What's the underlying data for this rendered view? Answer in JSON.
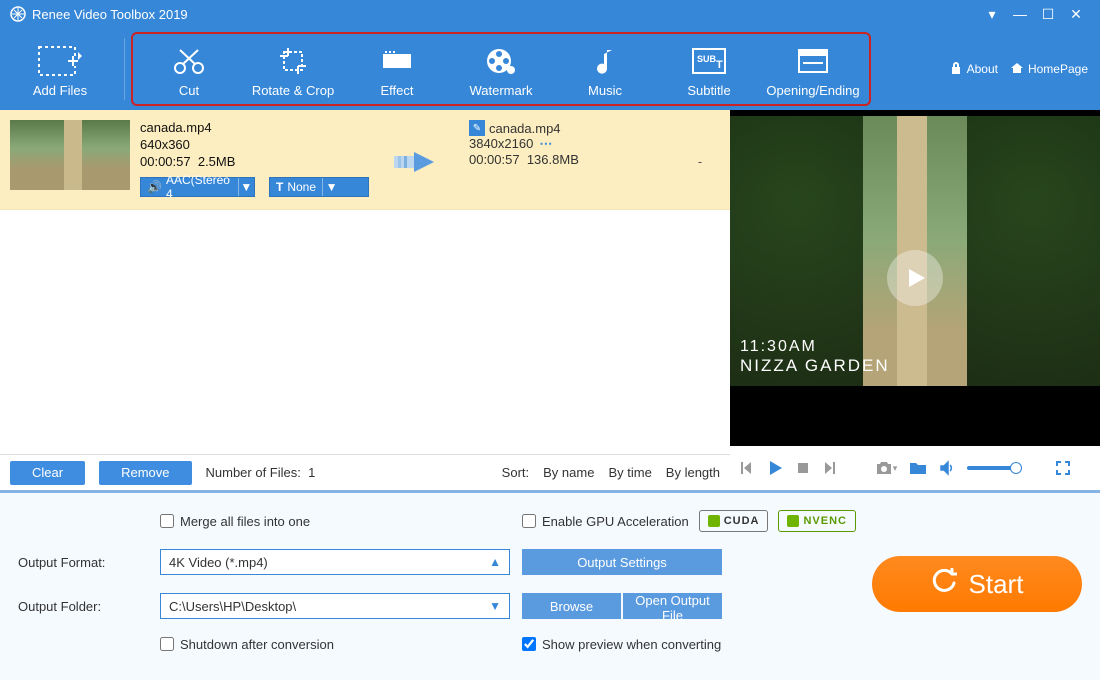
{
  "title": "Renee Video Toolbox 2019",
  "toolbar": {
    "add_files": "Add Files",
    "items": [
      {
        "label": "Cut"
      },
      {
        "label": "Rotate & Crop"
      },
      {
        "label": "Effect"
      },
      {
        "label": "Watermark"
      },
      {
        "label": "Music"
      },
      {
        "label": "Subtitle"
      },
      {
        "label": "Opening/Ending"
      }
    ],
    "about": "About",
    "homepage": "HomePage"
  },
  "file": {
    "source": {
      "name": "canada.mp4",
      "resolution": "640x360",
      "duration": "00:00:57",
      "size": "2.5MB"
    },
    "target": {
      "name": "canada.mp4",
      "resolution": "3840x2160",
      "duration": "00:00:57",
      "size": "136.8MB"
    },
    "audio_tag": "AAC(Stereo 4",
    "sub_tag": "None",
    "dash": "-"
  },
  "list_footer": {
    "clear": "Clear",
    "remove": "Remove",
    "count_label": "Number of Files:",
    "count": "1",
    "sort_label": "Sort:",
    "by_name": "By name",
    "by_time": "By time",
    "by_length": "By length"
  },
  "preview": {
    "caption_line1": "11:30AM",
    "caption_line2": "NIZZA GARDEN"
  },
  "bottom": {
    "merge": "Merge all files into one",
    "gpu": "Enable GPU Acceleration",
    "cuda": "CUDA",
    "nvenc": "NVENC",
    "output_format_label": "Output Format:",
    "output_format_value": "4K Video (*.mp4)",
    "output_settings": "Output Settings",
    "output_folder_label": "Output Folder:",
    "output_folder_value": "C:\\Users\\HP\\Desktop\\",
    "browse": "Browse",
    "open_output": "Open Output File",
    "shutdown": "Shutdown after conversion",
    "show_preview": "Show preview when converting",
    "start": "Start"
  }
}
